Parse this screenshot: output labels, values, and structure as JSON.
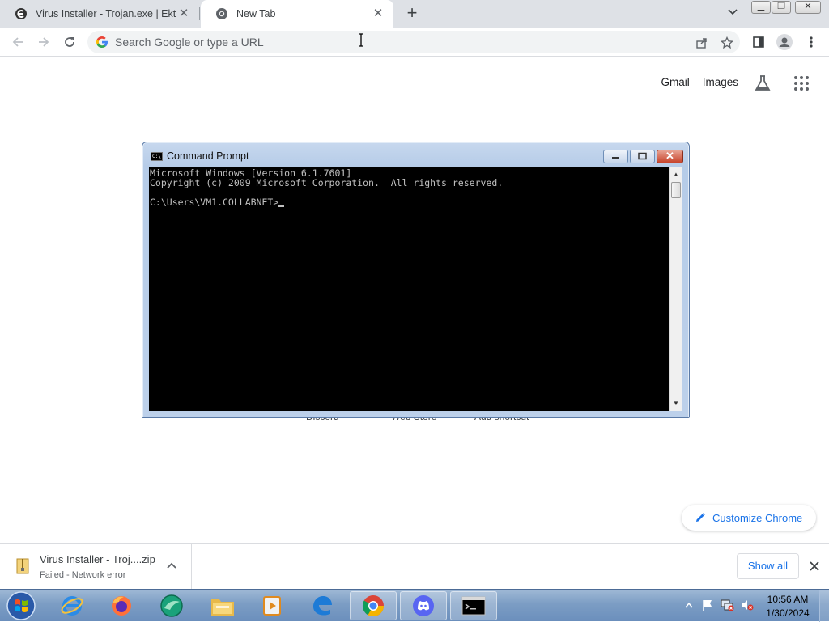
{
  "tabs": [
    {
      "title": "Virus Installer - Trojan.exe | Ektop",
      "active": false
    },
    {
      "title": "New Tab",
      "active": true
    }
  ],
  "omnibox": {
    "placeholder": "Search Google or type a URL"
  },
  "ntp": {
    "links": [
      "Gmail",
      "Images"
    ],
    "shortcut_labels": [
      "Discord",
      "Web Store",
      "Add shortcut"
    ],
    "customize_label": "Customize Chrome"
  },
  "cmd": {
    "title": "Command Prompt",
    "lines": [
      "Microsoft Windows [Version 6.1.7601]",
      "Copyright (c) 2009 Microsoft Corporation.  All rights reserved.",
      "",
      "C:\\Users\\VM1.COLLABNET>"
    ]
  },
  "download": {
    "filename": "Virus Installer - Troj....zip",
    "status": "Failed - Network error",
    "show_all": "Show all"
  },
  "taskbar": {
    "apps": [
      "internet-explorer",
      "firefox",
      "app-green",
      "file-explorer",
      "media-player",
      "edge",
      "chrome",
      "discord",
      "command-prompt"
    ],
    "clock_time": "10:56 AM",
    "clock_date": "1/30/2024"
  },
  "colors": {
    "accent": "#1a73e8",
    "tabstrip": "#dee1e6",
    "taskbar": "#7c9dc4"
  }
}
